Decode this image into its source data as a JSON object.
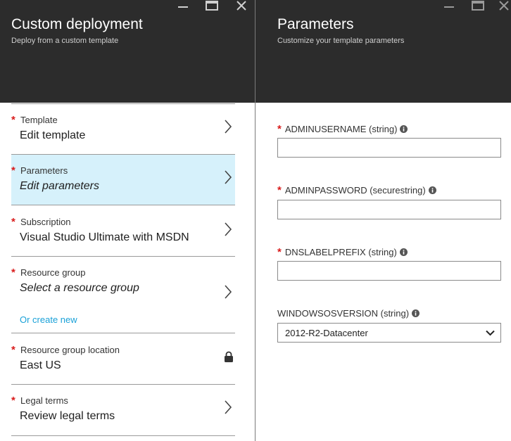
{
  "left_blade": {
    "title": "Custom deployment",
    "subtitle": "Deploy from a custom template",
    "items": [
      {
        "label": "Template",
        "value": "Edit template",
        "required": true
      },
      {
        "label": "Parameters",
        "value": "Edit parameters",
        "required": true,
        "selected": true
      },
      {
        "label": "Subscription",
        "value": "Visual Studio Ultimate with MSDN",
        "required": true
      },
      {
        "label": "Resource group",
        "value": "Select a resource group",
        "required": true,
        "link": "Or create new"
      },
      {
        "label": "Resource group location",
        "value": "East US",
        "required": true,
        "icon": "lock-icon"
      },
      {
        "label": "Legal terms",
        "value": "Review legal terms",
        "required": true
      }
    ]
  },
  "right_blade": {
    "title": "Parameters",
    "subtitle": "Customize your template parameters",
    "fields": [
      {
        "label": "ADMINUSERNAME (string)",
        "required": true,
        "value": ""
      },
      {
        "label": "ADMINPASSWORD (securestring)",
        "required": true,
        "value": ""
      },
      {
        "label": "DNSLABELPREFIX (string)",
        "required": true,
        "value": ""
      },
      {
        "label": "WINDOWSOSVERSION (string)",
        "required": false,
        "value": "2012-R2-Datacenter"
      }
    ]
  },
  "required_marker": "*",
  "colors": {
    "header_bg": "#2c2c2c",
    "selected_bg": "#d6f1fb",
    "required": "#d91c1c",
    "link": "#1aa1d8"
  }
}
